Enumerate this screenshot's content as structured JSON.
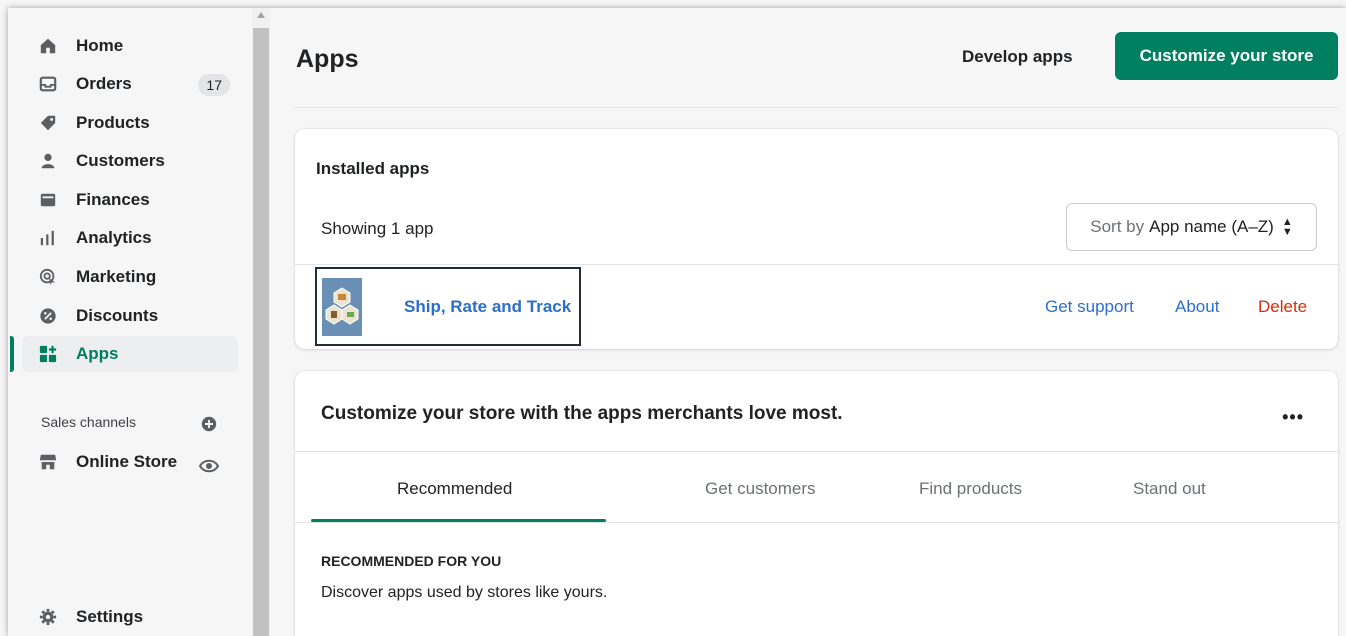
{
  "sidebar": {
    "items": [
      {
        "label": "Home",
        "icon": "home-icon"
      },
      {
        "label": "Orders",
        "icon": "inbox-icon",
        "badge": "17"
      },
      {
        "label": "Products",
        "icon": "tag-icon"
      },
      {
        "label": "Customers",
        "icon": "person-icon"
      },
      {
        "label": "Finances",
        "icon": "wallet-icon"
      },
      {
        "label": "Analytics",
        "icon": "bar-chart-icon"
      },
      {
        "label": "Marketing",
        "icon": "target-icon"
      },
      {
        "label": "Discounts",
        "icon": "discount-icon"
      },
      {
        "label": "Apps",
        "icon": "apps-icon",
        "active": true
      }
    ],
    "sales_channels_label": "Sales channels",
    "online_store_label": "Online Store",
    "settings_label": "Settings"
  },
  "header": {
    "title": "Apps",
    "develop_label": "Develop apps",
    "customize_label": "Customize your store"
  },
  "installed": {
    "title": "Installed apps",
    "showing": "Showing 1 app",
    "sort_prefix": "Sort by",
    "sort_value": "App name (A–Z)",
    "app": {
      "name": "Ship, Rate and Track",
      "get_support": "Get support",
      "about": "About",
      "delete": "Delete"
    }
  },
  "recommend": {
    "title": "Customize your store with the apps merchants love most.",
    "more": "•••",
    "tabs": [
      "Recommended",
      "Get customers",
      "Find products",
      "Stand out"
    ],
    "heading": "RECOMMENDED FOR YOU",
    "description": "Discover apps used by stores like yours."
  },
  "colors": {
    "primary": "#008060",
    "link": "#2c6ecb",
    "danger": "#d72c0d",
    "active_nav": "#007f5f"
  }
}
